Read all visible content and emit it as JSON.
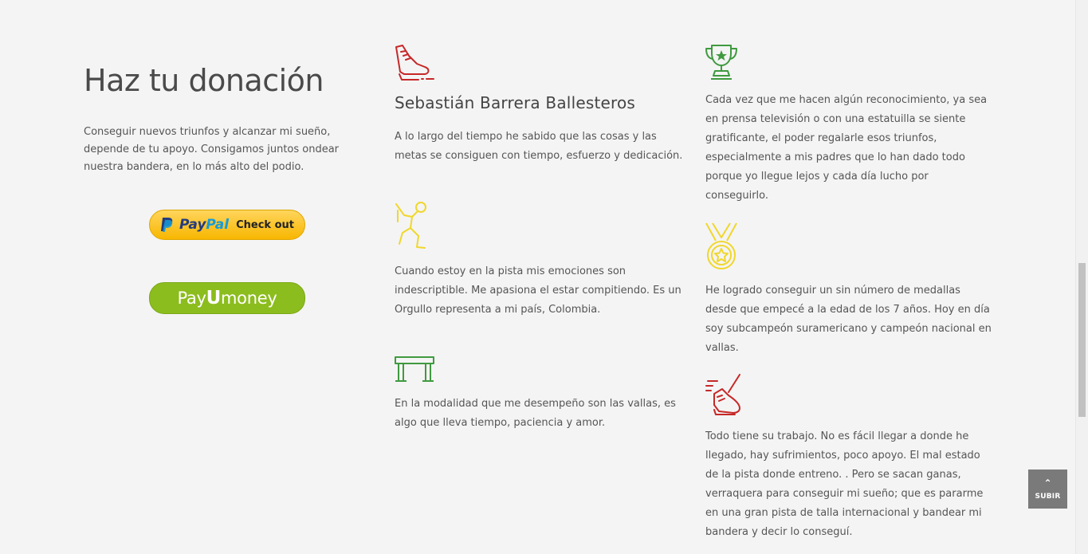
{
  "left": {
    "title": "Haz tu donación",
    "intro": "Conseguir nuevos triunfos y alcanzar mi sueño, depende de tu apoyo. Consigamos juntos ondear nuestra bandera, en lo más alto del podio."
  },
  "payments": {
    "paypal_logo_a": "Pay",
    "paypal_logo_b": "Pal",
    "paypal_check": "Check out",
    "payu_a": "Pay",
    "payu_u": "U",
    "payu_b": "money"
  },
  "features": {
    "f1_title": "Sebastián Barrera Ballesteros",
    "f1_text": "A lo largo del tiempo he sabido que las cosas y las metas se consiguen con tiempo, esfuerzo y dedicación.",
    "f2_text": "Cuando estoy en la pista mis emociones son indescriptible. Me apasiona el estar compitiendo. Es un Orgullo representa a mi país, Colombia.",
    "f3_text": "En la modalidad que me desempeño son las vallas, es algo que lleva tiempo, paciencia y amor.",
    "f4_text": "Cada vez que me hacen algún reconocimiento, ya sea en prensa televisión o con una estatuilla se siente gratificante, el poder regalarle esos triunfos, especialmente a mis padres que lo han dado todo porque yo llegue lejos y cada día lucho por conseguirlo.",
    "f5_text": "He logrado conseguir un sin número de medallas desde que empecé a la edad de los 7 años. Hoy en día soy subcampeón suramericano y campeón nacional en vallas.",
    "f6_text": "Todo tiene su trabajo. No es fácil llegar a donde he llegado, hay sufrimientos, poco apoyo. El mal estado de la pista donde entreno. . Pero se sacan ganas, verraquera para conseguir mi sueño; que es pararme en una gran pista de talla internacional y bandear mi bandera y decir lo conseguí."
  },
  "icons": {
    "f1": "running-shoe-icon",
    "f2": "athlete-jump-icon",
    "f3": "hurdle-icon",
    "f4": "trophy-icon",
    "f5": "medal-icon",
    "f6": "running-shoe-speed-icon"
  },
  "colors": {
    "red": "#c62828",
    "green": "#3f9a3f",
    "yellow": "#f0d72c",
    "paypal_yellow": "#fcc439",
    "payu_green": "#8cbd1e",
    "subir_bg": "#7a7a7a"
  },
  "back_to_top": {
    "arrow": "⌃",
    "label": "SUBIR"
  }
}
